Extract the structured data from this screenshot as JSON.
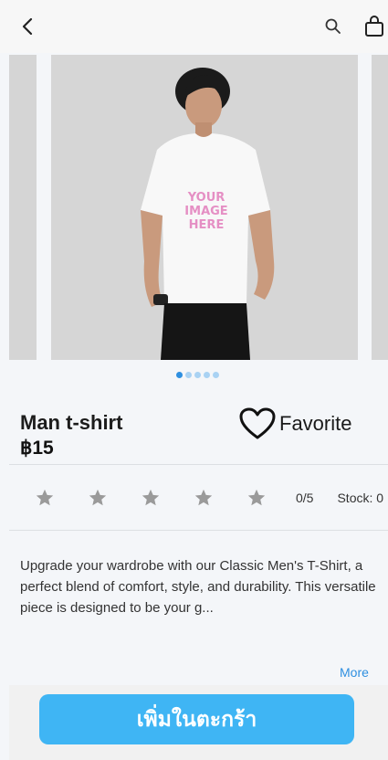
{
  "product": {
    "title": "Man t-shirt",
    "price": "฿15",
    "favorite_label": "Favorite",
    "tshirt_print": [
      "YOUR",
      "IMAGE",
      "HERE"
    ],
    "rating": {
      "value": 0,
      "max": 5,
      "text": "0/5"
    },
    "stock_text": "Stock: 0",
    "description": "Upgrade your wardrobe with our Classic Men's T-Shirt, a perfect blend of comfort, style, and durability. This versatile piece is designed to be your g...",
    "more_label": "More"
  },
  "carousel": {
    "dot_count": 5,
    "active_index": 0
  },
  "actions": {
    "add_to_cart_label": "เพิ่มในตะกร้า"
  },
  "icons": {
    "back": "chevron-left-icon",
    "search": "search-icon",
    "bag": "shopping-bag-icon",
    "favorite": "heart-outline-icon",
    "star": "star-icon"
  },
  "colors": {
    "accent": "#2e8fe0",
    "button": "#3fb5f4",
    "star": "#9a9a9a"
  }
}
